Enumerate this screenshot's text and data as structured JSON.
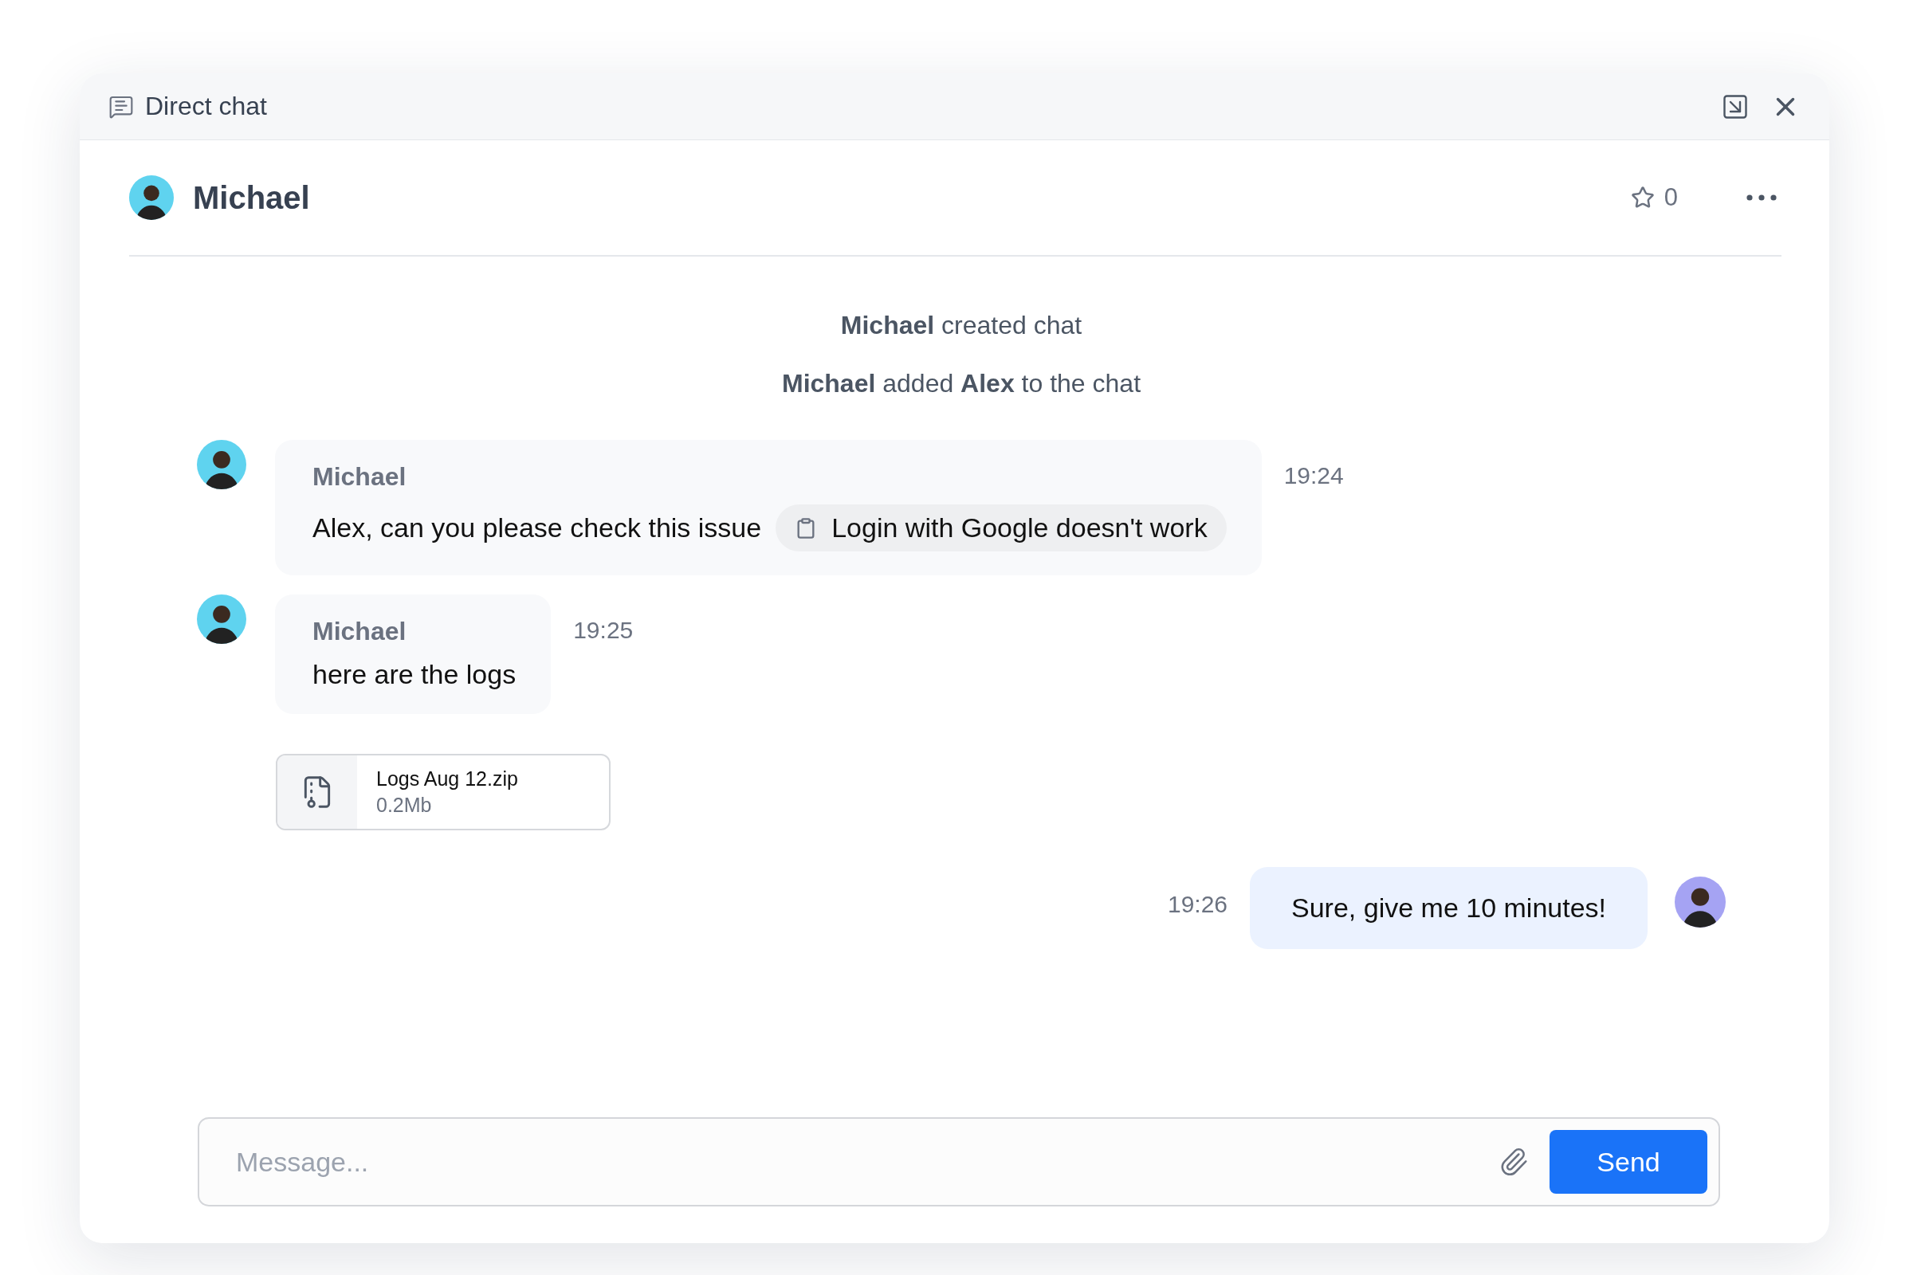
{
  "window": {
    "title": "Direct chat"
  },
  "chat_header": {
    "name": "Michael",
    "star_count": "0",
    "starred": false
  },
  "messages": [
    {
      "kind": "system",
      "text": "**Michael** created chat"
    },
    {
      "kind": "system",
      "text": "**Michael** added **Alex** to the chat"
    },
    {
      "kind": "incoming",
      "author": "Michael",
      "text": "Alex, can you please check this issue",
      "issue": "Login with Google doesn't work",
      "time": "19:24"
    },
    {
      "kind": "incoming",
      "author": "Michael",
      "text": "here are the logs",
      "time": "19:25"
    },
    {
      "kind": "file",
      "file_name": "Logs Aug 12.zip",
      "file_size": "0.2Mb"
    },
    {
      "kind": "outgoing",
      "text": "Sure, give me 10 minutes!",
      "time": "19:26"
    }
  ],
  "composer": {
    "placeholder": "Message...",
    "send_label": "Send"
  }
}
